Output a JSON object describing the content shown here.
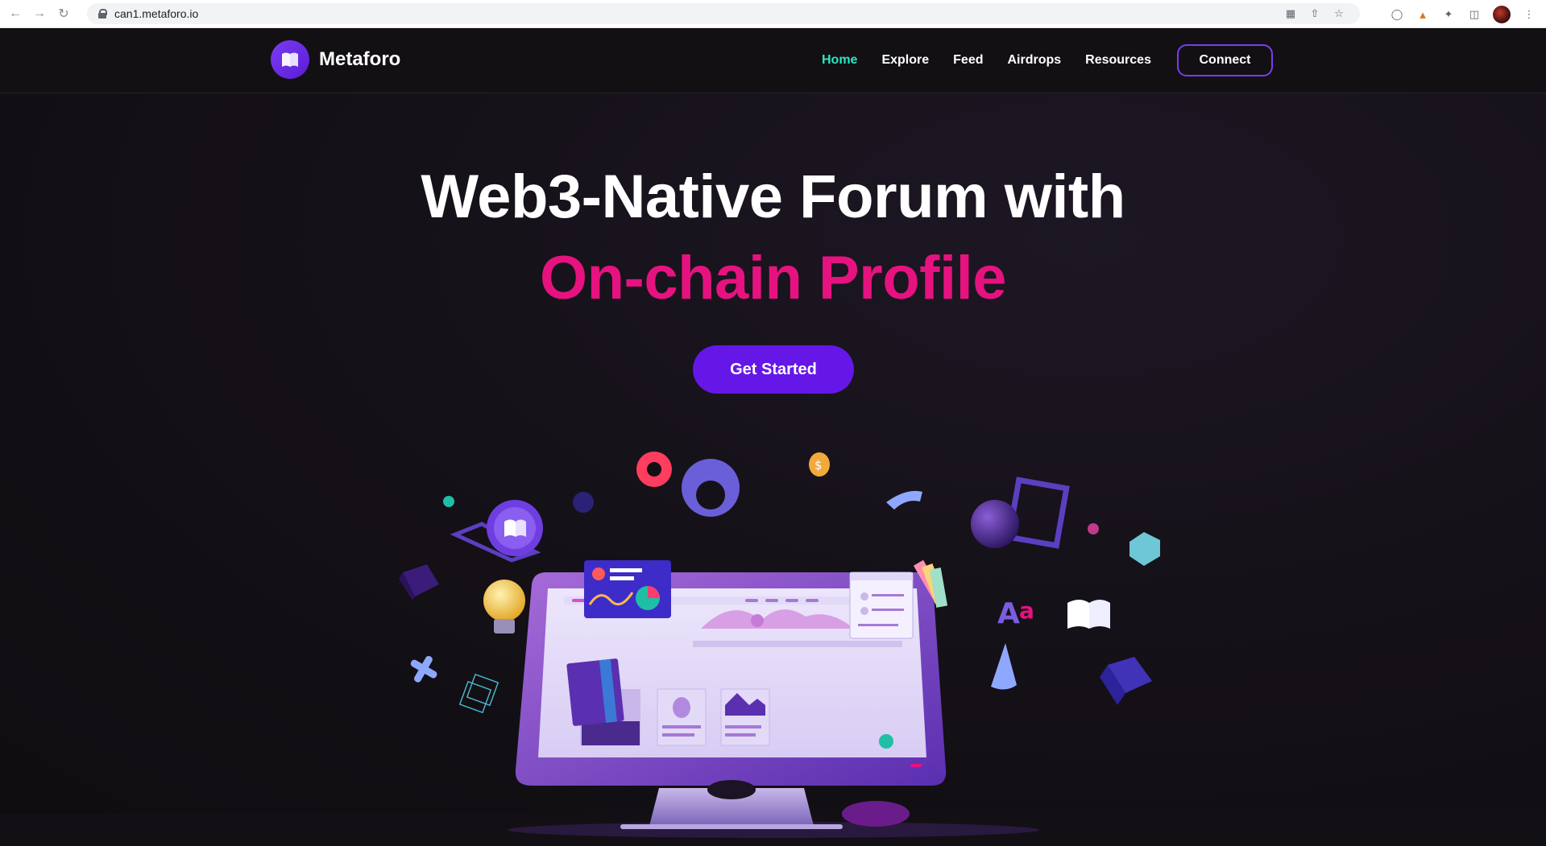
{
  "browser": {
    "url": "can1.metaforo.io",
    "back_icon": "arrow-left-icon",
    "forward_icon": "arrow-right-icon",
    "reload_icon": "reload-icon"
  },
  "header": {
    "logo_text": "Metaforo",
    "nav": {
      "home": "Home",
      "explore": "Explore",
      "feed": "Feed",
      "airdrops": "Airdrops",
      "resources": "Resources"
    },
    "connect_label": "Connect"
  },
  "hero": {
    "title_line1": "Web3-Native Forum with",
    "title_line2": "On-chain Profile",
    "cta_label": "Get Started"
  },
  "colors": {
    "accent_purple": "#6517e8",
    "accent_pink": "#e6127f",
    "nav_active": "#2ee6c2",
    "background": "#121015"
  }
}
